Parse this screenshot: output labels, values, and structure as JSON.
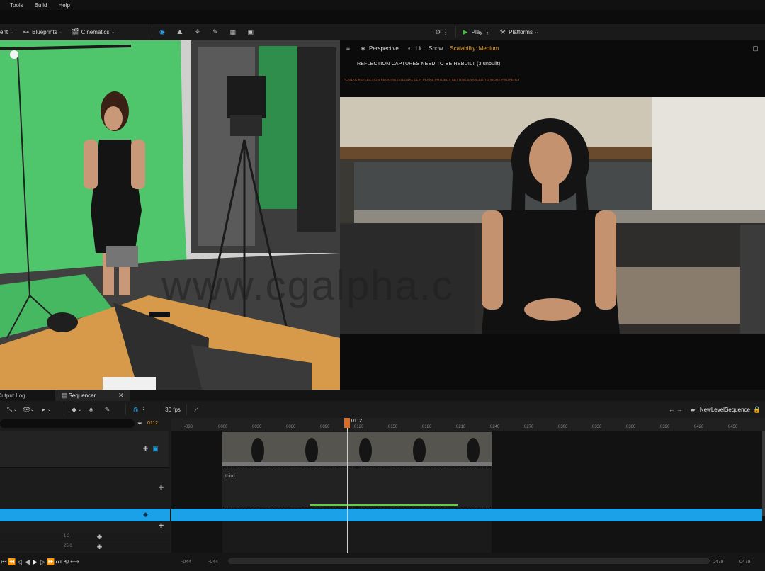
{
  "menu": {
    "tools": "Tools",
    "build": "Build",
    "help": "Help"
  },
  "toolbar": {
    "content_label": "ent",
    "blueprints_label": "Blueprints",
    "cinematics_label": "Cinematics",
    "play_label": "Play",
    "platforms_label": "Platforms"
  },
  "viewport": {
    "perspective_label": "Perspective",
    "lit_label": "Lit",
    "show_label": "Show",
    "scalability_label": "Scalability: Medium",
    "reflection_msg": "REFLECTION CAPTURES NEED TO BE REBUILT (3 unbuilt)",
    "warning_msg": "PLANAR REFLECTION REQUIRES GLOBAL CLIP PLANE PROJECT SETTING ENABLED TO WORK PROPERLY"
  },
  "watermark": "www.cgalpha.c",
  "sequencer": {
    "output_log_tab": "Output Log",
    "sequencer_tab": "Sequencer",
    "fps_label": "30 fps",
    "current_frame": "0112",
    "playhead_label": "0112",
    "sequence_name": "NewLevelSequence",
    "ruler_ticks": [
      "-030",
      "0000",
      "0030",
      "0060",
      "0090",
      "0120",
      "0150",
      "0180",
      "0210",
      "0240",
      "0270",
      "0300",
      "0330",
      "0360",
      "0390",
      "0420",
      "0450"
    ],
    "clip_label": "third",
    "track_values": [
      "1.2",
      "25.0"
    ],
    "range_start_1": "-044",
    "range_start_2": "-044",
    "range_end_1": "0479",
    "range_end_2": "0479"
  },
  "colors": {
    "accent": "#1aa1e8",
    "play": "#3fbd3f",
    "scalability": "#e8a23a",
    "warn": "#b8592e",
    "greenscreen": "#4fc66b"
  }
}
